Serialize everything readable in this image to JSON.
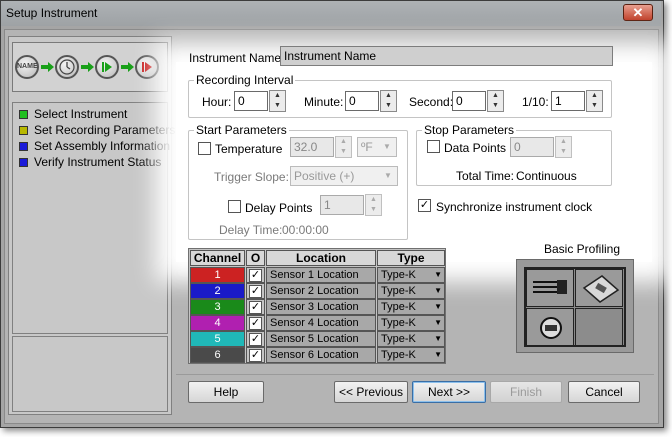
{
  "window": {
    "title": "Setup Instrument",
    "close_glyph": "✕"
  },
  "flow": {
    "name_badge": "NAME",
    "icons": [
      "name-circle-icon",
      "clock-icon",
      "play-icon",
      "record-icon"
    ]
  },
  "steps": [
    {
      "label": "Select Instrument",
      "color": "#1fbf1f"
    },
    {
      "label": "Set Recording Parameters",
      "color": "#b8b800"
    },
    {
      "label": "Set Assembly Information",
      "color": "#1a1ad8"
    },
    {
      "label": "Verify Instrument Status",
      "color": "#1a1ad8"
    }
  ],
  "instrument": {
    "name_label": "Instrument Name:",
    "name_value": "Instrument Name"
  },
  "recording": {
    "legend": "Recording Interval",
    "hour_label": "Hour:",
    "hour_value": "0",
    "minute_label": "Minute:",
    "minute_value": "0",
    "second_label": "Second:",
    "second_value": "0",
    "tenth_label": "1/10:",
    "tenth_value": "1"
  },
  "start": {
    "legend": "Start Parameters",
    "temperature_label": "Temperature",
    "temperature_value": "32.0",
    "unit": "ºF",
    "trigger_label": "Trigger Slope:",
    "trigger_value": "Positive (+)",
    "delay_label": "Delay Points",
    "delay_value": "1",
    "delay_time_label": "Delay Time:",
    "delay_time_value": "00:00:00"
  },
  "stop": {
    "legend": "Stop Parameters",
    "data_points_label": "Data Points",
    "data_points_value": "0",
    "total_time_label": "Total Time:",
    "total_time_value": "Continuous"
  },
  "sync": {
    "label": "Synchronize instrument clock",
    "checked": true,
    "check_glyph": "✓"
  },
  "table": {
    "headers": [
      "Channel",
      "O",
      "Location",
      "Type"
    ],
    "rows": [
      {
        "channel": "1",
        "color": "#cc2222",
        "checked": "✓",
        "location": "Sensor 1 Location",
        "type": "Type-K"
      },
      {
        "channel": "2",
        "color": "#1a1ac8",
        "checked": "✓",
        "location": "Sensor 2 Location",
        "type": "Type-K"
      },
      {
        "channel": "3",
        "color": "#1a8a1a",
        "checked": "✓",
        "location": "Sensor 3 Location",
        "type": "Type-K"
      },
      {
        "channel": "4",
        "color": "#b020b0",
        "checked": "✓",
        "location": "Sensor 4 Location",
        "type": "Type-K"
      },
      {
        "channel": "5",
        "color": "#20b8b8",
        "checked": "✓",
        "location": "Sensor 5 Location",
        "type": "Type-K"
      },
      {
        "channel": "6",
        "color": "#4a4a4a",
        "checked": "✓",
        "location": "Sensor 6 Location",
        "type": "Type-K"
      }
    ]
  },
  "profiling": {
    "label": "Basic Profiling"
  },
  "buttons": {
    "help": "Help",
    "previous": "<< Previous",
    "next": "Next >>",
    "finish": "Finish",
    "cancel": "Cancel"
  },
  "glyphs": {
    "spin_up": "▲",
    "spin_down": "▼",
    "dropdown": "▼",
    "flow_arrow": "➡"
  }
}
